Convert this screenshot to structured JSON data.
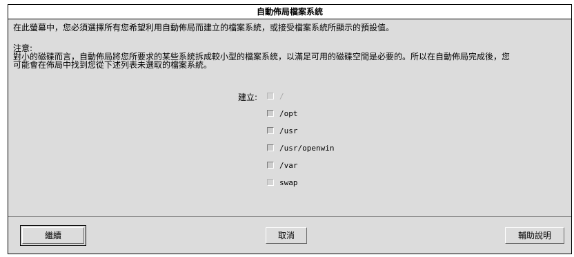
{
  "dialog": {
    "title": "自動佈局檔案系統",
    "intro": "在此螢幕中，您必須選擇所有您希望利用自動佈局而建立的檔案系統，或接受檔案系統所顯示的預設值。",
    "note_heading": "注意:",
    "note_line1": "對小的磁碟而言，自動佈局將您所要求的某些系統拆成較小型的檔案系統，以滿足可用的磁碟空間是必要的。所以在自動佈局完成後，您",
    "note_line2": "可能會在佈局中找到您從下述列表未選取的檔案系統。",
    "create_label": "建立:",
    "filesystems": [
      {
        "name": "/",
        "checked": false,
        "enabled": false
      },
      {
        "name": "/opt",
        "checked": false,
        "enabled": true
      },
      {
        "name": "/usr",
        "checked": false,
        "enabled": true
      },
      {
        "name": "/usr/openwin",
        "checked": false,
        "enabled": true
      },
      {
        "name": "/var",
        "checked": false,
        "enabled": true
      },
      {
        "name": "swap",
        "checked": false,
        "enabled": false
      }
    ]
  },
  "buttons": {
    "continue": "繼續",
    "cancel": "取消",
    "help": "輔助說明"
  }
}
